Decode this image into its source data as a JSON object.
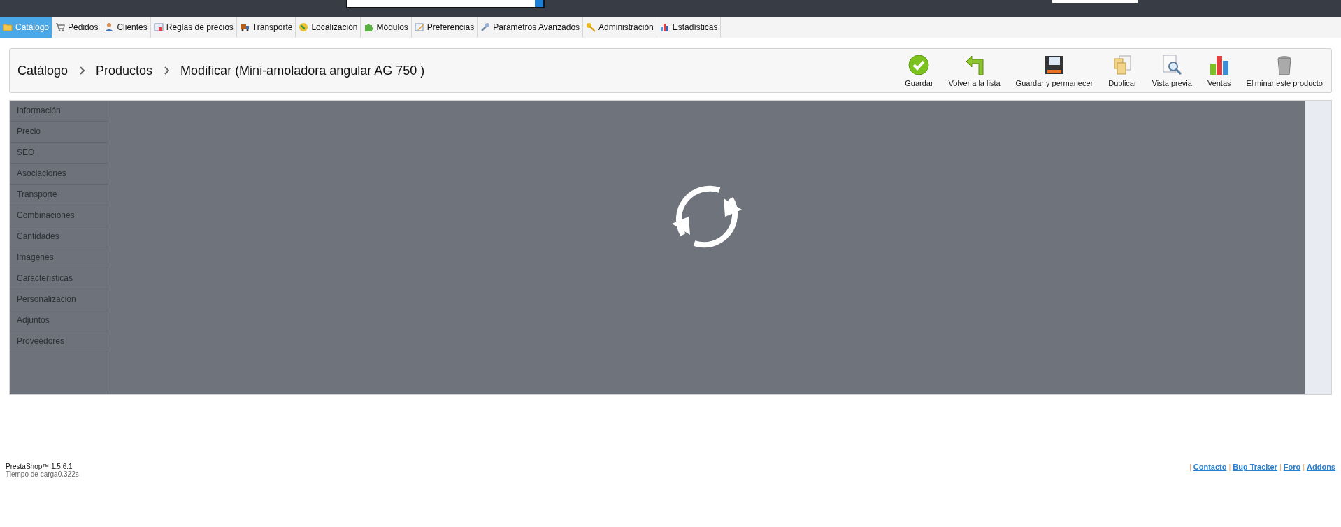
{
  "top_bar": {
    "search": {
      "kind": "field"
    }
  },
  "menu": [
    {
      "label": "Catálogo",
      "selected": true
    },
    {
      "label": "Pedidos",
      "selected": false
    },
    {
      "label": "Clientes",
      "selected": false
    },
    {
      "label": "Reglas de precios",
      "selected": false
    },
    {
      "label": "Transporte",
      "selected": false
    },
    {
      "label": "Localización",
      "selected": false
    },
    {
      "label": "Módulos",
      "selected": false
    },
    {
      "label": "Preferencias",
      "selected": false
    },
    {
      "label": "Parámetros Avanzados",
      "selected": false
    },
    {
      "label": "Administración",
      "selected": false
    },
    {
      "label": "Estadísticas",
      "selected": false
    }
  ],
  "breadcrumb": [
    "Catálogo",
    "Productos",
    "Modificar (Mini-amoladora angular AG 750 )"
  ],
  "toolbar": [
    "Guardar",
    "Volver a la lista",
    "Guardar y permanecer",
    "Duplicar",
    "Vista previa",
    "Ventas",
    "Eliminar este producto"
  ],
  "sidebar": {
    "items": [
      "Información",
      "Precio",
      "SEO",
      "Asociaciones",
      "Transporte",
      "Combinaciones",
      "Cantidades",
      "Imágenes",
      "Características",
      "Personalización",
      "Adjuntos",
      "Proveedores"
    ]
  },
  "loading": true,
  "footer": {
    "version": "PrestaShop™ 1.5.6.1",
    "load_time": "Tiempo de carga0.322s",
    "separator": "|",
    "links": [
      "Contacto",
      "Bug Tracker",
      "Foro",
      "Addons"
    ]
  }
}
